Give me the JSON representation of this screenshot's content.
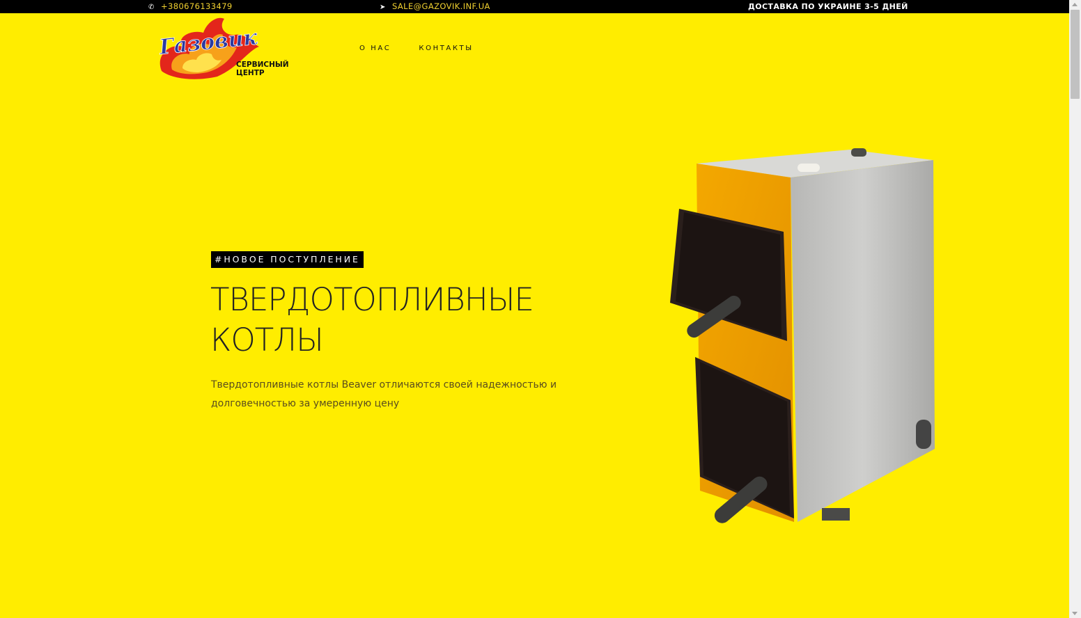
{
  "topbar": {
    "phone": "+380676133479",
    "phone_icon": "phone-icon",
    "email": "SALE@GAZOVIK.INF.UA",
    "email_icon": "paper-plane-icon",
    "delivery": "ДОСТАВКА ПО УКРАИНЕ 3-5 ДНЕЙ"
  },
  "logo": {
    "brand": "Газовик",
    "line1": "СЕРВИСНЫЙ",
    "line2": "ЦЕНТР"
  },
  "nav": {
    "items": [
      {
        "label": "О НАС"
      },
      {
        "label": "КОНТАКТЫ"
      }
    ]
  },
  "hero": {
    "badge": "#НОВОЕ ПОСТУПЛЕНИЕ",
    "title_line1": "ТВЕРДОТОПЛИВНЫЕ",
    "title_line2": "КОТЛЫ",
    "description": "Твердотопливные котлы Beaver отличаются своей надежностью и долговечностью за умеренную цену"
  },
  "colors": {
    "background": "#ffed00",
    "topbar": "#000000",
    "topbar_link": "#f2d230",
    "badge_bg": "#000000"
  }
}
